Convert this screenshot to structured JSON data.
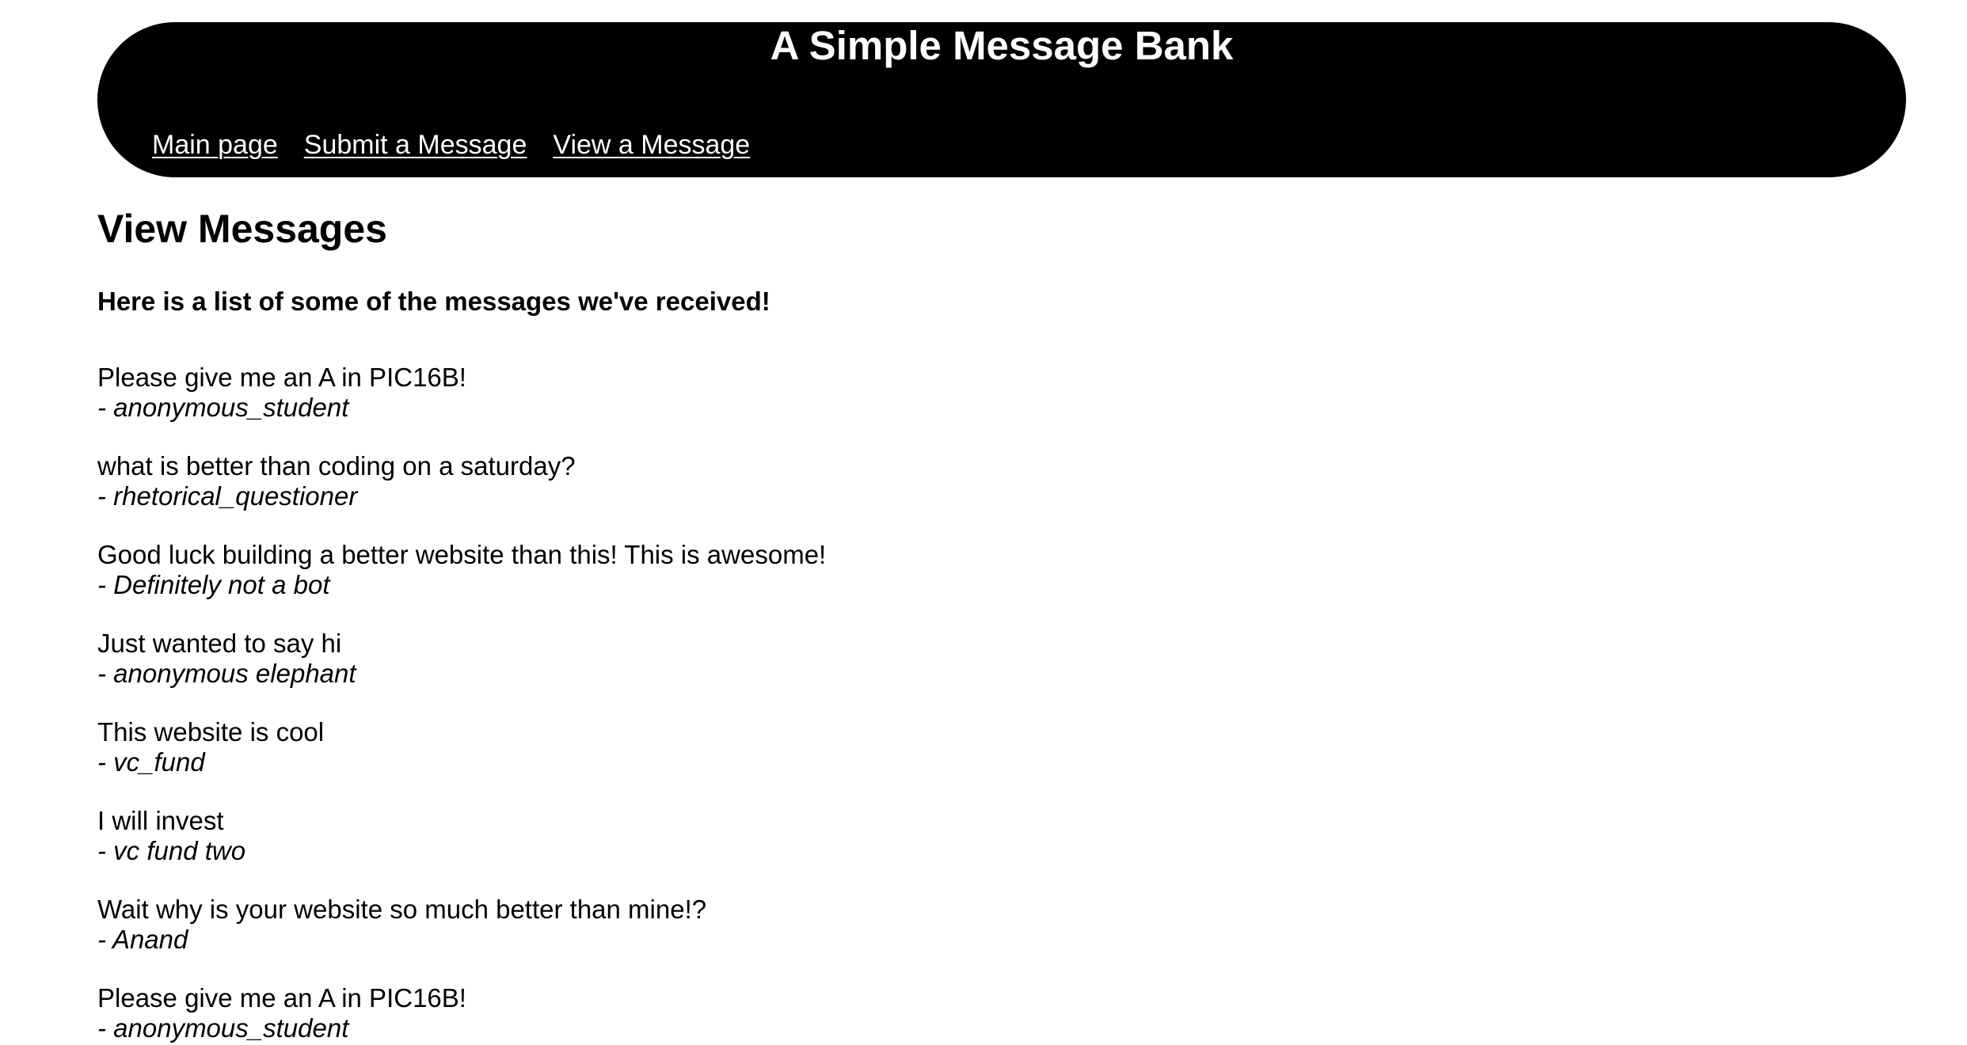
{
  "header": {
    "title": "A Simple Message Bank",
    "nav": [
      {
        "label": "Main page"
      },
      {
        "label": "Submit a Message"
      },
      {
        "label": "View a Message"
      }
    ]
  },
  "main": {
    "title": "View Messages",
    "subtitle": "Here is a list of some of the messages we've received!",
    "messages": [
      {
        "text": "Please give me an A in PIC16B!",
        "author": "- anonymous_student"
      },
      {
        "text": "what is better than coding on a saturday?",
        "author": "- rhetorical_questioner"
      },
      {
        "text": "Good luck building a better website than this! This is awesome!",
        "author": "- Definitely not a bot"
      },
      {
        "text": "Just wanted to say hi",
        "author": "- anonymous elephant"
      },
      {
        "text": "This website is cool",
        "author": "- vc_fund"
      },
      {
        "text": "I will invest",
        "author": "- vc fund two"
      },
      {
        "text": "Wait why is your website so much better than mine!?",
        "author": "- Anand"
      },
      {
        "text": "Please give me an A in PIC16B!",
        "author": "- anonymous_student"
      }
    ]
  }
}
